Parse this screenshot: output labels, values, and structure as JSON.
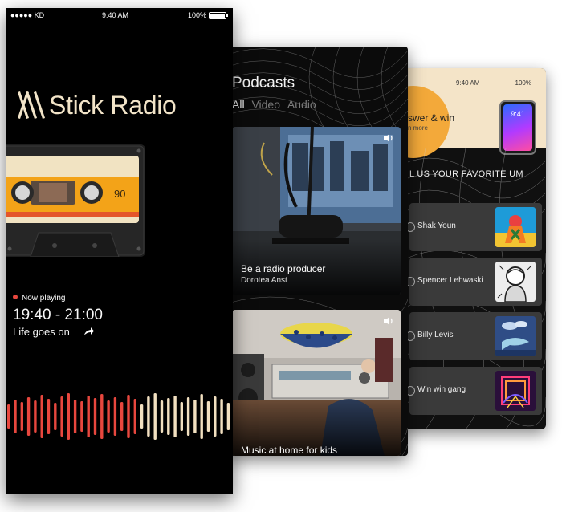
{
  "screen1": {
    "status": {
      "carrier": "●●●●● KD",
      "time": "9:40 AM",
      "battery": "100%"
    },
    "app_title": "Stick Radio",
    "cassette_label": "90",
    "now_playing_label": "Now playing",
    "time_range": "19:40 - 21:00",
    "show_name": "Life goes on",
    "colors": {
      "accent": "#e8473e",
      "title": "#f2e4c8",
      "wave_cream": "#f2e0c0"
    }
  },
  "screen2": {
    "title": "Podcasts",
    "tabs": [
      {
        "label": "All",
        "active": true
      },
      {
        "label": "Video",
        "active": false
      },
      {
        "label": "Audio",
        "active": false
      }
    ],
    "cards": [
      {
        "title": "Be a radio producer",
        "subtitle": "Dorotea Anst"
      },
      {
        "title": "Music at home for kids",
        "subtitle": ""
      }
    ]
  },
  "screen3": {
    "status": {
      "time": "9:40 AM",
      "battery": "100%"
    },
    "promo_title": "swer & win",
    "promo_sub": "n more",
    "phone_time": "9:41",
    "heading": "L US YOUR FAVORITE UM",
    "albums": [
      {
        "name": "Shak Youn"
      },
      {
        "name": "Spencer Lehwaski"
      },
      {
        "name": "Billy Levis"
      },
      {
        "name": "Win win gang"
      }
    ]
  }
}
